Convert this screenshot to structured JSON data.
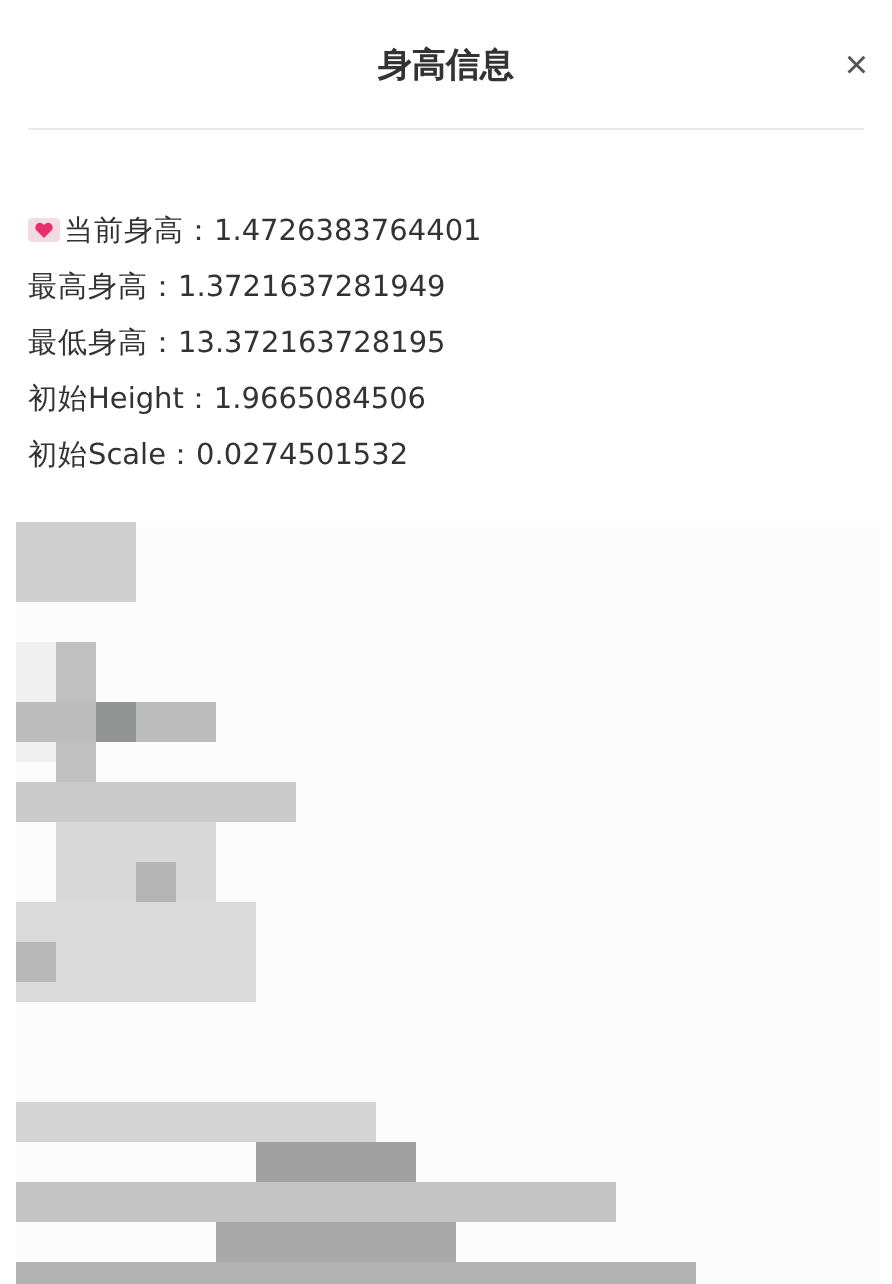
{
  "dialog": {
    "title": "身高信息",
    "close": "×"
  },
  "lines": [
    {
      "kind": "heart",
      "text": "当前身高：1.4726383764401"
    },
    {
      "kind": "plain",
      "text": "最高身高：1.3721637281949"
    },
    {
      "kind": "plain",
      "text": "最低身高：13.372163728195"
    },
    {
      "kind": "plain",
      "text": "初始Height：1.9665084506"
    },
    {
      "kind": "plain",
      "text": "初始Scale：0.0274501532"
    }
  ]
}
